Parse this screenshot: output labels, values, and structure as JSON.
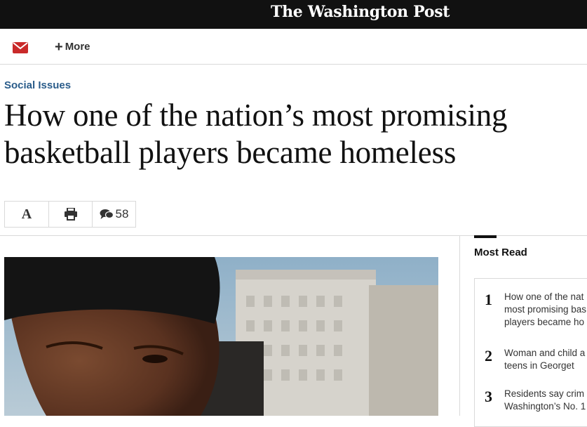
{
  "masthead": {
    "logo_text": "The Washington Post"
  },
  "toolbar": {
    "mail_icon": "envelope-icon",
    "more_label": "More",
    "more_icon": "plus-icon"
  },
  "article": {
    "kicker": "Social Issues",
    "headline": "How one of the nation’s most promising basketball players became homeless"
  },
  "tools": {
    "font_icon_label": "A",
    "print_icon": "printer-icon",
    "comments_icon": "speech-bubbles-icon",
    "comment_count": "58"
  },
  "most_read": {
    "title": "Most Read",
    "items": [
      {
        "rank": "1",
        "text": "How one of the nat most promising bas players became ho"
      },
      {
        "rank": "2",
        "text": "Woman and child a by teens in Georget"
      },
      {
        "rank": "3",
        "text": "Residents say crim Washington’s No. 1"
      }
    ]
  },
  "colors": {
    "masthead_bg": "#111111",
    "kicker": "#2a5c8a",
    "mail_icon": "#c92a2a"
  }
}
